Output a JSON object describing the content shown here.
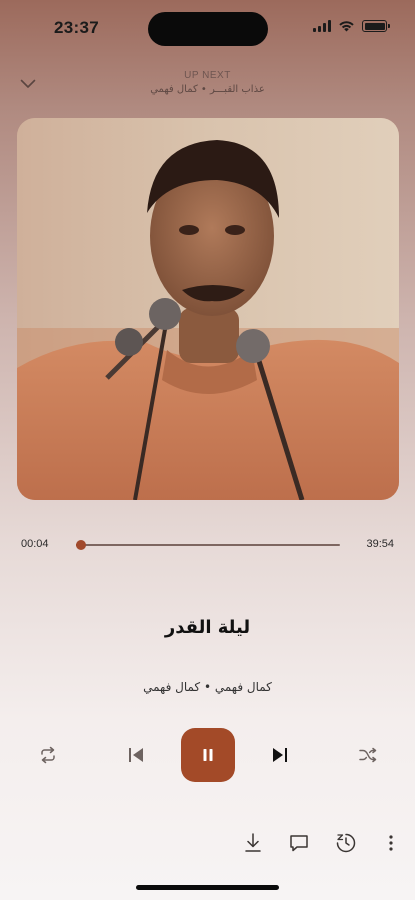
{
  "status_bar": {
    "time": "23:37",
    "battery_level": 1.0
  },
  "header": {
    "up_next_label": "UP NEXT",
    "up_next_title": "عذاب القبـــر • كمال فهمي"
  },
  "player": {
    "elapsed": "00:04",
    "duration": "39:54",
    "progress": 0.0017,
    "title": "ليلة القدر",
    "artist": "كمال فهمي • كمال فهمي",
    "state": "playing"
  },
  "icons": {
    "collapse": "chevron-down-icon",
    "repeat": "repeat-icon",
    "previous": "skip-previous-icon",
    "pause": "pause-icon",
    "next": "skip-next-icon",
    "shuffle": "shuffle-icon",
    "download": "download-icon",
    "comment": "comment-icon",
    "sleep_timer": "sleep-timer-icon",
    "more": "more-vertical-icon"
  },
  "colors": {
    "accent": "#a34a28",
    "progress": "#a14a2c",
    "top_gradient": "#9c6a5c",
    "bottom_gradient": "#f7f4f4"
  }
}
